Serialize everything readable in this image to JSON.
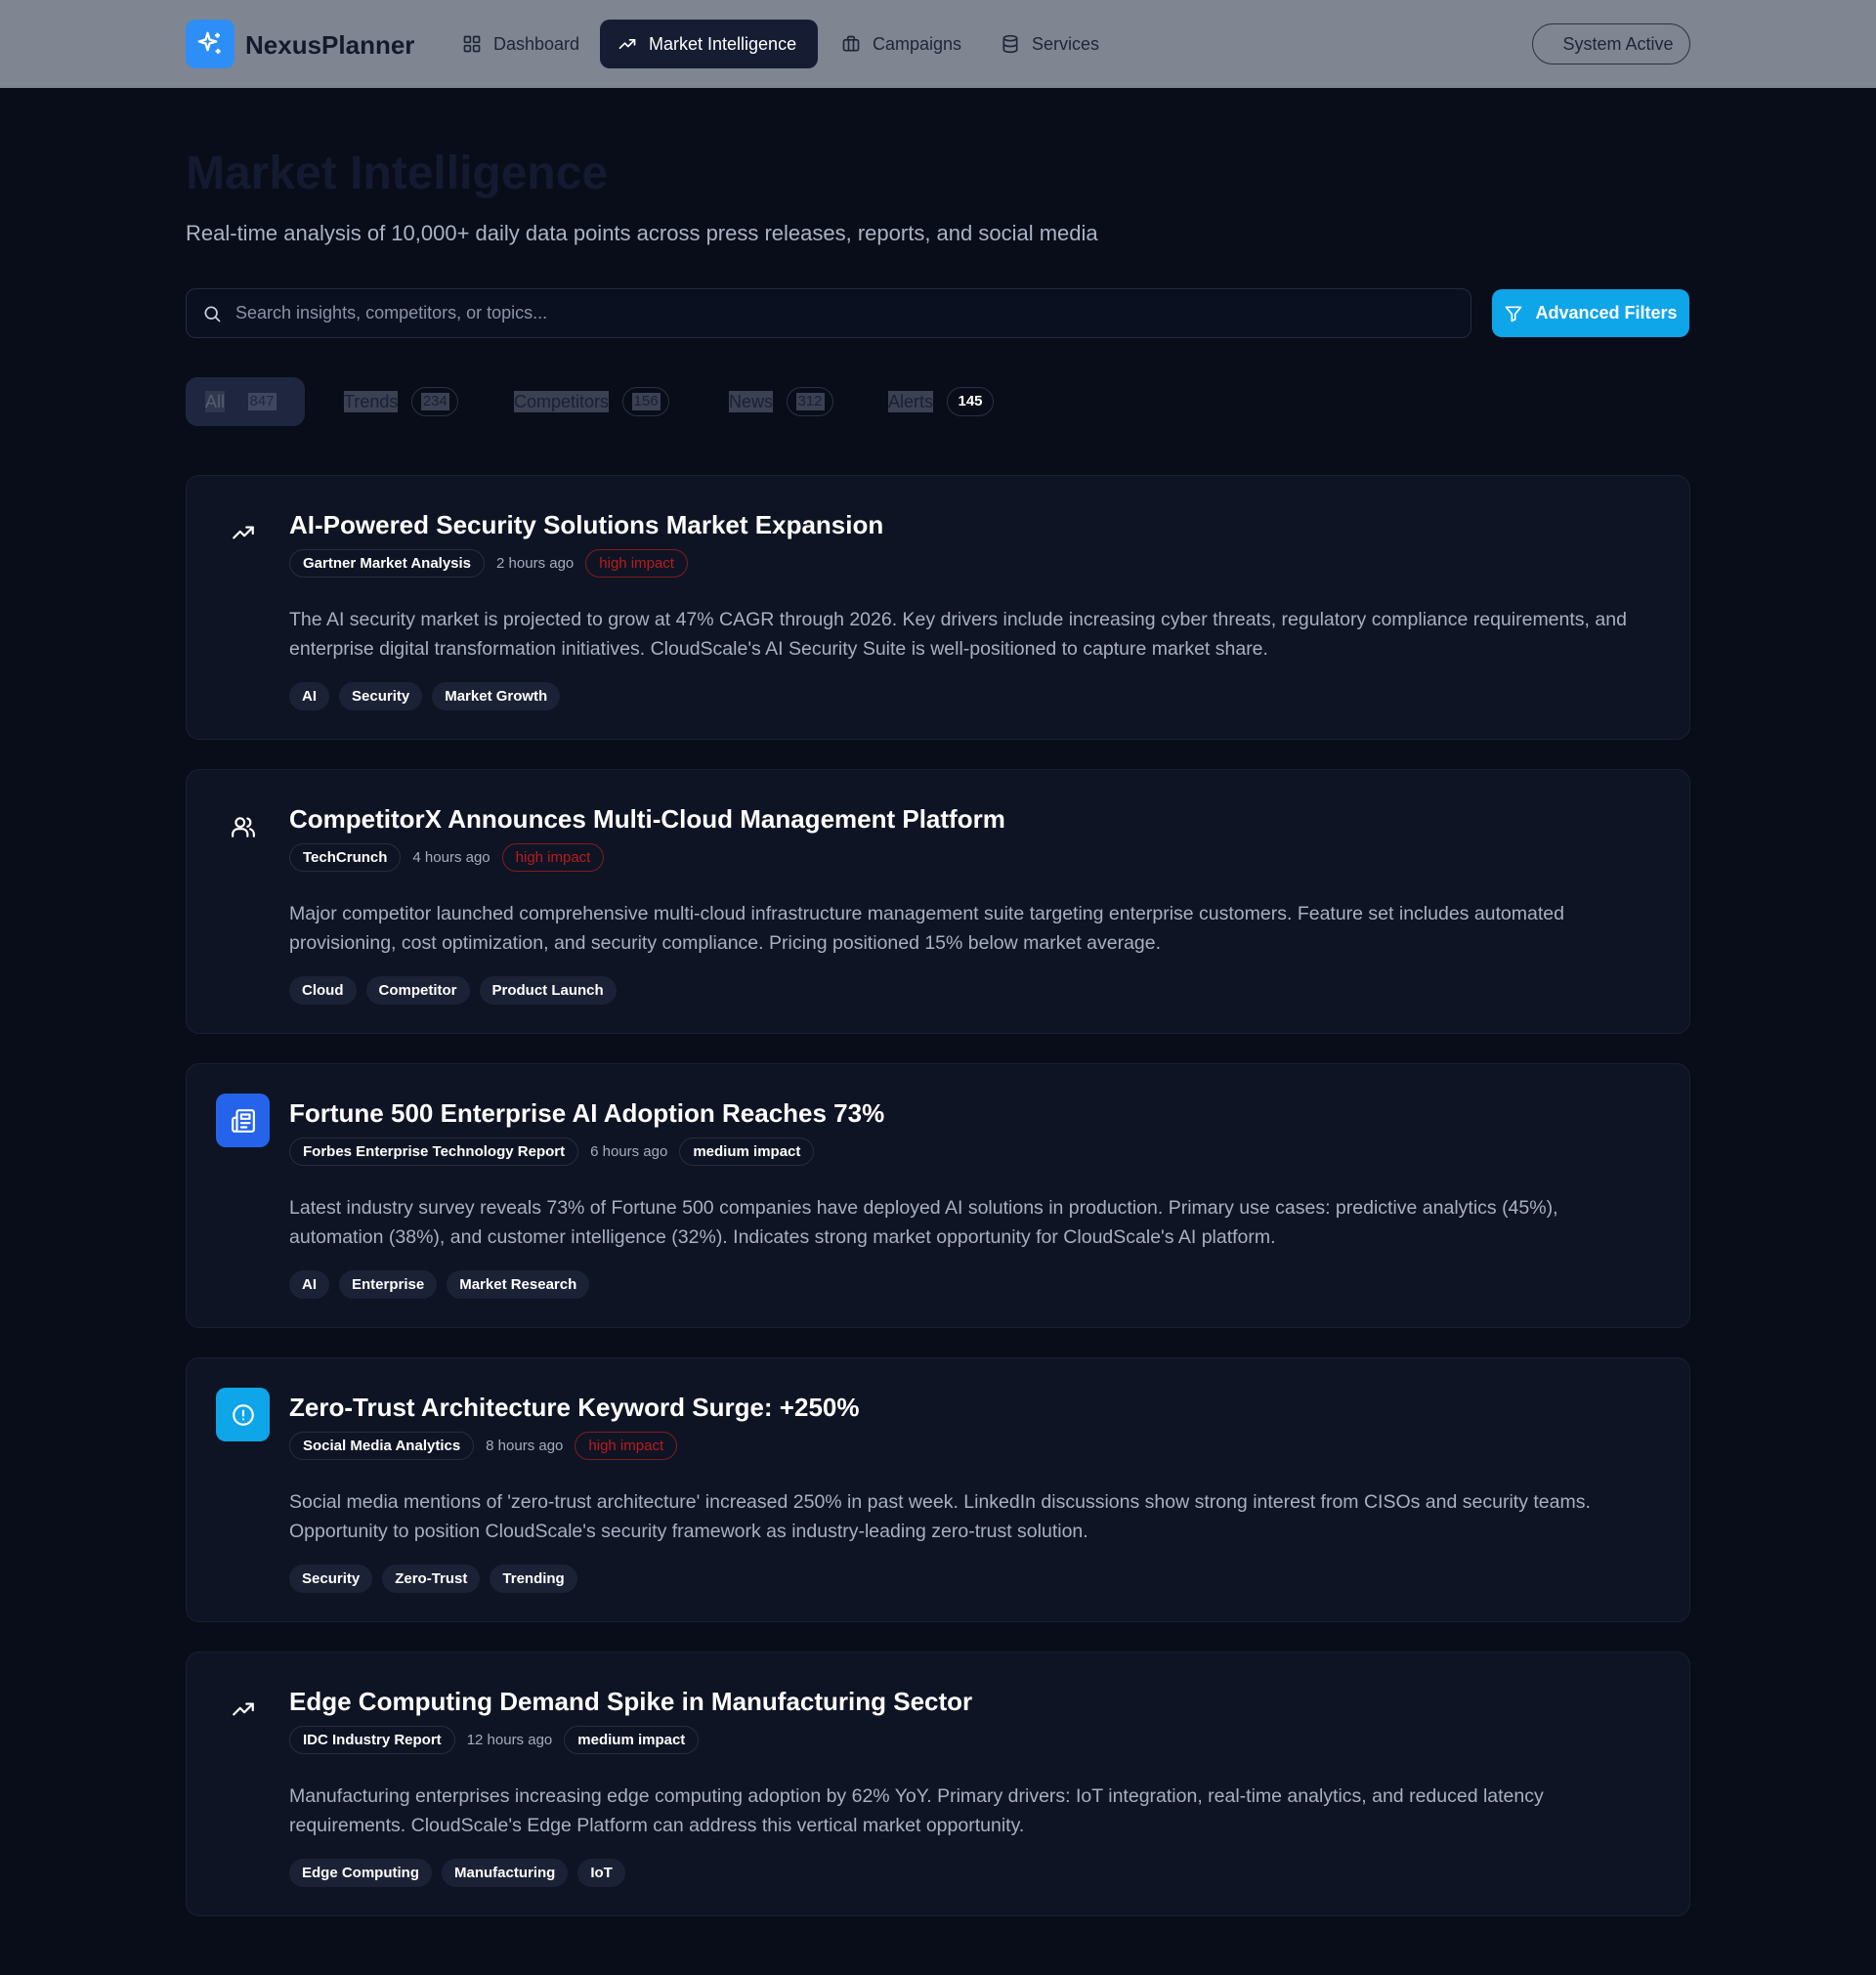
{
  "header": {
    "brand": "NexusPlanner",
    "logo_icon": "sparkle-icon",
    "nav": [
      {
        "label": "Dashboard",
        "icon": "grid-icon",
        "active": false
      },
      {
        "label": "Market Intelligence",
        "icon": "trending-up-icon",
        "active": true
      },
      {
        "label": "Campaigns",
        "icon": "briefcase-icon",
        "active": false
      },
      {
        "label": "Services",
        "icon": "database-icon",
        "active": false
      }
    ],
    "status": "System Active"
  },
  "page": {
    "title": "Market Intelligence",
    "subtitle": "Real-time analysis of 10,000+ daily data points across press releases, reports, and social media"
  },
  "search": {
    "placeholder": "Search insights, competitors, or topics...",
    "value": "",
    "filter_button": "Advanced Filters"
  },
  "tabs": [
    {
      "label": "All",
      "count": "847",
      "active": true
    },
    {
      "label": "Trends",
      "count": "234",
      "active": false
    },
    {
      "label": "Competitors",
      "count": "156",
      "active": false
    },
    {
      "label": "News",
      "count": "312",
      "active": false
    },
    {
      "label": "Alerts",
      "count": "145",
      "active": false
    }
  ],
  "insights": [
    {
      "icon": "trending-up-icon",
      "title": "AI-Powered Security Solutions Market Expansion",
      "source": "Gartner Market Analysis",
      "time": "2 hours ago",
      "impact": "high impact",
      "description": "The AI security market is projected to grow at 47% CAGR through 2026. Key drivers include increasing cyber threats, regulatory compliance requirements, and enterprise digital transformation initiatives. CloudScale's AI Security Suite is well-positioned to capture market share.",
      "tags": [
        "AI",
        "Security",
        "Market Growth"
      ]
    },
    {
      "icon": "users-icon",
      "title": "CompetitorX Announces Multi-Cloud Management Platform",
      "source": "TechCrunch",
      "time": "4 hours ago",
      "impact": "high impact",
      "description": "Major competitor launched comprehensive multi-cloud infrastructure management suite targeting enterprise customers. Feature set includes automated provisioning, cost optimization, and security compliance. Pricing positioned 15% below market average.",
      "tags": [
        "Cloud",
        "Competitor",
        "Product Launch"
      ]
    },
    {
      "icon": "newspaper-icon",
      "title": "Fortune 500 Enterprise AI Adoption Reaches 73%",
      "source": "Forbes Enterprise Technology Report",
      "time": "6 hours ago",
      "impact": "medium impact",
      "description": "Latest industry survey reveals 73% of Fortune 500 companies have deployed AI solutions in production. Primary use cases: predictive analytics (45%), automation (38%), and customer intelligence (32%). Indicates strong market opportunity for CloudScale's AI platform.",
      "tags": [
        "AI",
        "Enterprise",
        "Market Research"
      ]
    },
    {
      "icon": "alert-circle-icon",
      "title": "Zero-Trust Architecture Keyword Surge: +250%",
      "source": "Social Media Analytics",
      "time": "8 hours ago",
      "impact": "high impact",
      "description": "Social media mentions of 'zero-trust architecture' increased 250% in past week. LinkedIn discussions show strong interest from CISOs and security teams. Opportunity to position CloudScale's security framework as industry-leading zero-trust solution.",
      "tags": [
        "Security",
        "Zero-Trust",
        "Trending"
      ]
    },
    {
      "icon": "trending-up-icon",
      "title": "Edge Computing Demand Spike in Manufacturing Sector",
      "source": "IDC Industry Report",
      "time": "12 hours ago",
      "impact": "medium impact",
      "description": "Manufacturing enterprises increasing edge computing adoption by 62% YoY. Primary drivers: IoT integration, real-time analytics, and reduced latency requirements. CloudScale's Edge Platform can address this vertical market opportunity.",
      "tags": [
        "Edge Computing",
        "Manufacturing",
        "IoT"
      ]
    }
  ],
  "colors": {
    "accent": "#0ea5e9",
    "logo": "#2e8ef7",
    "high_impact": "#b91c1c",
    "background": "#090d1a",
    "card": "#0f1424"
  }
}
